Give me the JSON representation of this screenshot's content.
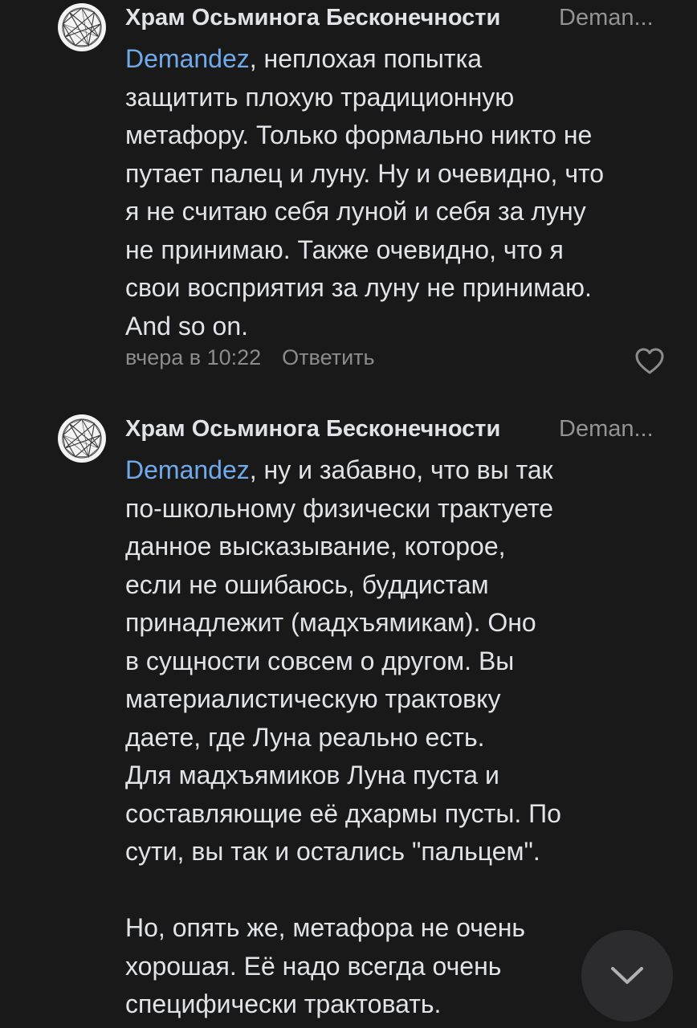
{
  "comments": [
    {
      "author": "Храм Осьминога Бесконечности",
      "reply_to": "Deman...",
      "mention": "Demandez",
      "first_line_rest": ", неплохая попытка",
      "lines": [
        "защитить плохую традиционную",
        "метафору. Только формально никто не",
        "путает палец и луну. Ну и очевидно, что",
        "я не считаю себя луной и себя за луну",
        "не принимаю. Также очевидно, что я",
        "свои восприятия за луну не принимаю.",
        "And so on."
      ],
      "time": "вчера в 10:22",
      "reply_label": "Ответить",
      "like_icon": "heart-outline-icon"
    },
    {
      "author": "Храм Осьминога Бесконечности",
      "reply_to": "Deman...",
      "mention": "Demandez",
      "first_line_rest": ", ну и забавно, что вы так",
      "lines": [
        "по-школьному физически трактуете",
        "данное высказывание, которое,",
        "если не ошибаюсь, буддистам",
        "принадлежит (мадхъямикам). Оно",
        "в сущности совсем о другом. Вы",
        "материалистическую трактовку",
        "даете, где Луна реально есть.",
        "Для мадхъямиков Луна пуста и",
        "составляющие её дхармы пусты. По",
        "сути, вы так и остались \"пальцем\".",
        "",
        "Но, опять же, метафора не очень",
        "хорошая. Её надо всегда очень",
        "специфически трактовать."
      ]
    }
  ],
  "scroll_down_icon": "chevron-down-icon",
  "colors": {
    "background": "#19191a",
    "text": "#e1e3e6",
    "secondary": "#8b8c8e",
    "mention": "#71aaeb"
  }
}
